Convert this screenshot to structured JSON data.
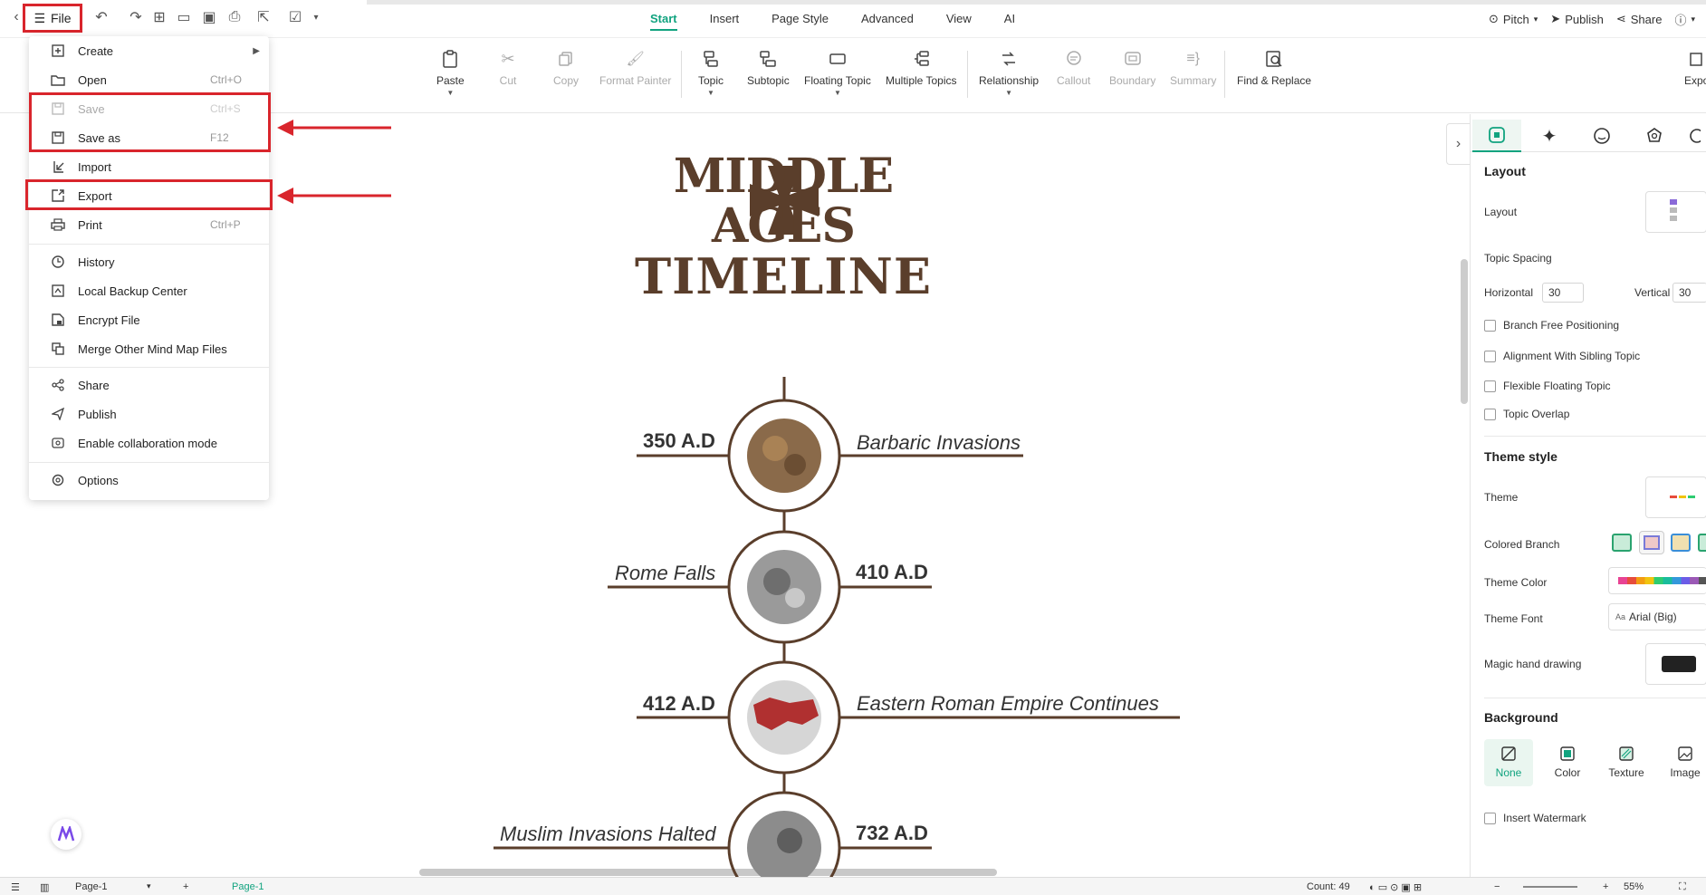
{
  "topbar": {
    "file_label": "File",
    "tabs": [
      {
        "label": "Start",
        "active": true
      },
      {
        "label": "Insert"
      },
      {
        "label": "Page Style"
      },
      {
        "label": "Advanced"
      },
      {
        "label": "View"
      },
      {
        "label": "AI"
      }
    ],
    "right": {
      "pitch": "Pitch",
      "publish": "Publish",
      "share": "Share"
    }
  },
  "ribbon": {
    "paste": "Paste",
    "cut": "Cut",
    "copy": "Copy",
    "format_painter": "Format Painter",
    "topic": "Topic",
    "subtopic": "Subtopic",
    "floating_topic": "Floating Topic",
    "multiple_topics": "Multiple Topics",
    "relationship": "Relationship",
    "callout": "Callout",
    "boundary": "Boundary",
    "summary": "Summary",
    "find_replace": "Find & Replace",
    "export_cut": "Expo"
  },
  "file_menu": {
    "items": [
      {
        "label": "Create",
        "shortcut": "",
        "icon": "plus-square-icon",
        "submenu": true
      },
      {
        "label": "Open",
        "shortcut": "Ctrl+O",
        "icon": "folder-icon"
      },
      {
        "label": "Save",
        "shortcut": "Ctrl+S",
        "icon": "save-icon",
        "disabled": true
      },
      {
        "label": "Save as",
        "shortcut": "F12",
        "icon": "save-as-icon"
      },
      {
        "label": "Import",
        "shortcut": "",
        "icon": "import-icon"
      },
      {
        "label": "Export",
        "shortcut": "",
        "icon": "export-icon"
      },
      {
        "label": "Print",
        "shortcut": "Ctrl+P",
        "icon": "printer-icon"
      },
      {
        "label": "History",
        "shortcut": "",
        "icon": "clock-icon"
      },
      {
        "label": "Local Backup Center",
        "shortcut": "",
        "icon": "backup-icon"
      },
      {
        "label": "Encrypt File",
        "shortcut": "",
        "icon": "lock-file-icon"
      },
      {
        "label": "Merge Other Mind Map Files",
        "shortcut": "",
        "icon": "merge-icon"
      },
      {
        "label": "Share",
        "shortcut": "",
        "icon": "share-icon"
      },
      {
        "label": "Publish",
        "shortcut": "",
        "icon": "send-icon"
      },
      {
        "label": "Enable collaboration mode",
        "shortcut": "",
        "icon": "collab-icon"
      },
      {
        "label": "Options",
        "shortcut": "",
        "icon": "gear-icon"
      }
    ]
  },
  "mindmap": {
    "title_line1": "MIDDLE AGES",
    "title_line2": "TIMELINE",
    "nodes": [
      {
        "date": "350 A.D",
        "event": "Barbaric Invasions"
      },
      {
        "date": "410 A.D",
        "event": "Rome Falls"
      },
      {
        "date": "412 A.D",
        "event": "Eastern Roman Empire Continues"
      },
      {
        "date": "732 A.D",
        "event": "Muslim Invasions Halted"
      }
    ]
  },
  "panel": {
    "layout_heading": "Layout",
    "layout_label": "Layout",
    "topic_spacing": "Topic Spacing",
    "horizontal_label": "Horizontal",
    "horizontal_value": "30",
    "vertical_label": "Vertical",
    "vertical_value": "30",
    "checks": [
      "Branch Free Positioning",
      "Alignment With Sibling Topic",
      "Flexible Floating Topic",
      "Topic Overlap"
    ],
    "theme_style_heading": "Theme style",
    "theme_label": "Theme",
    "colored_branch_label": "Colored Branch",
    "theme_color_label": "Theme Color",
    "theme_font_label": "Theme Font",
    "theme_font_value": "Arial (Big)",
    "magic_hand_label": "Magic hand drawing",
    "background_heading": "Background",
    "bg_options": [
      "None",
      "Color",
      "Texture",
      "Image"
    ],
    "watermark_label": "Insert Watermark"
  },
  "bottombar": {
    "page_select": "Page-1",
    "page_tab": "Page-1",
    "count": "Count: 49",
    "zoom": "55%"
  },
  "colors": {
    "accent": "#11a37f",
    "highlight": "#d9252c",
    "brown": "#5a3e2b"
  }
}
